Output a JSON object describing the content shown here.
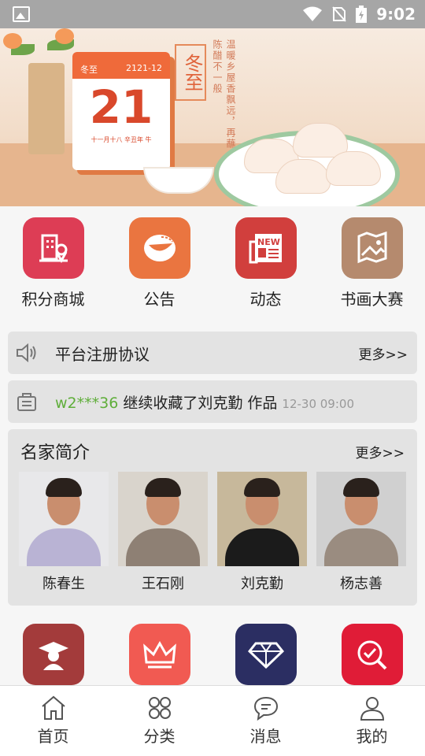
{
  "status_bar": {
    "time": "9:02"
  },
  "banner": {
    "calendar_header_left": "冬至",
    "calendar_header_right": "2121-12",
    "calendar_day": "21",
    "calendar_lunar": "十一月十八 辛丑年 牛",
    "title": "冬至",
    "poem": "温暖乡屋香飘远，再蘸陈醋不一般"
  },
  "shortcuts": [
    {
      "label": "积分商城",
      "color": "#dd3d55",
      "icon": "building-location-icon"
    },
    {
      "label": "公告",
      "color": "#ea7540",
      "icon": "announcement-icon"
    },
    {
      "label": "动态",
      "color": "#d13f3d",
      "icon": "news-icon"
    },
    {
      "label": "书画大赛",
      "color": "#b58a6e",
      "icon": "painting-scroll-icon"
    }
  ],
  "notice_bar": {
    "text": "平台注册协议",
    "more": "更多>>"
  },
  "activity_bar": {
    "user": "w2***36",
    "text": " 继续收藏了刘克勤 作品",
    "time": "12-30 09:00"
  },
  "famous": {
    "title": "名家简介",
    "more": "更多>>",
    "artists": [
      {
        "name": "陈春生",
        "bg": "#e8e8ea",
        "shirt": "#b9b3d4"
      },
      {
        "name": "王石刚",
        "bg": "#d9d4cc",
        "shirt": "#8e8074"
      },
      {
        "name": "刘克勤",
        "bg": "#c7b89b",
        "shirt": "#1b1b1b"
      },
      {
        "name": "杨志善",
        "bg": "#d0d0d0",
        "shirt": "#9a8c80"
      }
    ]
  },
  "shortcuts2": [
    {
      "color": "#a33b3b",
      "icon": "graduate-icon"
    },
    {
      "color": "#f15a52",
      "icon": "crown-icon"
    },
    {
      "color": "#2b2e62",
      "icon": "diamond-icon"
    },
    {
      "color": "#e01c37",
      "icon": "search-check-icon"
    }
  ],
  "tabbar": [
    {
      "label": "首页",
      "icon": "home-icon"
    },
    {
      "label": "分类",
      "icon": "category-icon"
    },
    {
      "label": "消息",
      "icon": "message-icon"
    },
    {
      "label": "我的",
      "icon": "user-icon"
    }
  ]
}
